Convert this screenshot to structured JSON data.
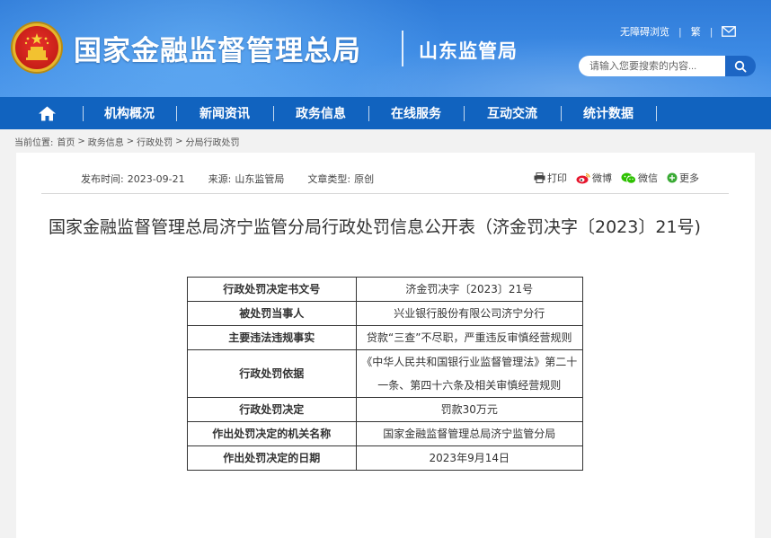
{
  "header": {
    "site_title": "国家金融监督管理总局",
    "sub_title": "山东监管局",
    "accessibility": "无障碍浏览",
    "traditional": "繁",
    "search_placeholder": "请输入您要搜索的内容...",
    "brand_color": "#1163bf"
  },
  "nav": {
    "items": [
      "机构概况",
      "新闻资讯",
      "政务信息",
      "在线服务",
      "互动交流",
      "统计数据"
    ]
  },
  "breadcrumb": {
    "label": "当前位置:",
    "items": [
      "首页",
      "政务信息",
      "行政处罚",
      "分局行政处罚"
    ]
  },
  "meta": {
    "date_label": "发布时间:",
    "date": "2023-09-21",
    "source_label": "来源:",
    "source": "山东监管局",
    "type_label": "文章类型:",
    "type": "原创"
  },
  "share": {
    "print": "打印",
    "weibo": "微博",
    "wechat": "微信",
    "more": "更多"
  },
  "article": {
    "title": "国家金融监督管理总局济宁监管分局行政处罚信息公开表（济金罚决字〔2023〕21号)"
  },
  "table": {
    "rows": [
      {
        "key": "行政处罚决定书文号",
        "value": "济金罚决字〔2023〕21号"
      },
      {
        "key": "被处罚当事人",
        "value": "兴业银行股份有限公司济宁分行"
      },
      {
        "key": "主要违法违规事实",
        "value": "贷款“三查”不尽职，严重违反审慎经营规则"
      },
      {
        "key": "行政处罚依据",
        "value": "《中华人民共和国银行业监督管理法》第二十一条、第四十六条及相关审慎经营规则"
      },
      {
        "key": "行政处罚决定",
        "value": "罚款30万元"
      },
      {
        "key": "作出处罚决定的机关名称",
        "value": "国家金融监督管理总局济宁监管分局"
      },
      {
        "key": "作出处罚决定的日期",
        "value": "2023年9月14日"
      }
    ]
  }
}
